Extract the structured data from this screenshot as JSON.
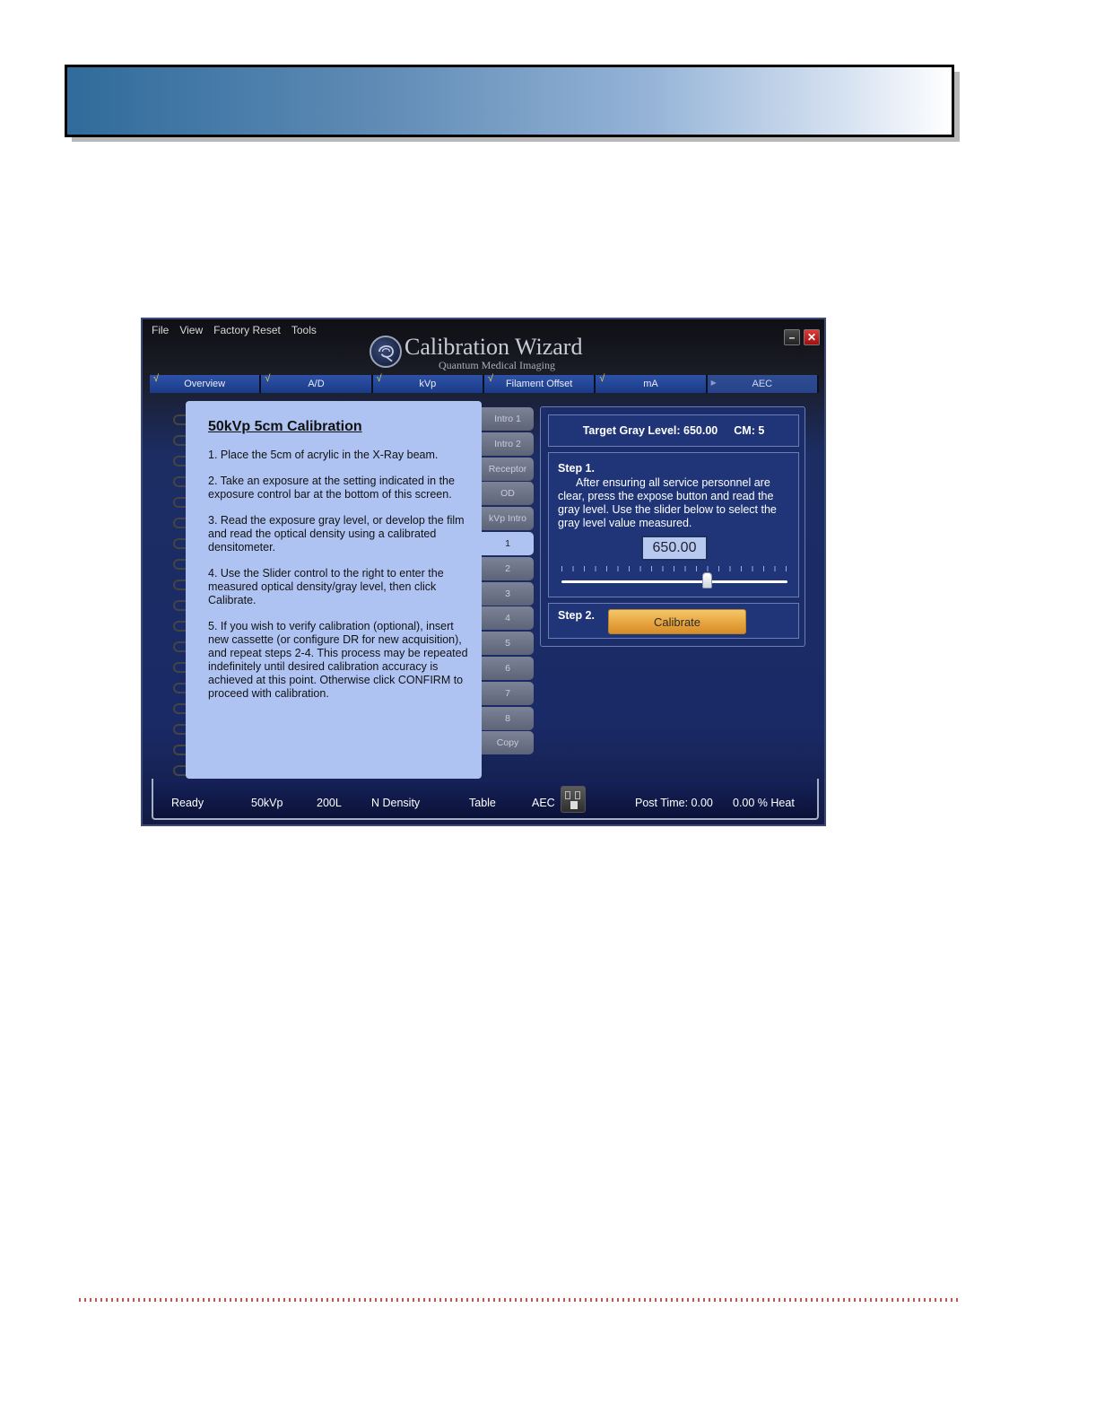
{
  "app": {
    "title": "Calibration Wizard",
    "subtitle": "Quantum Medical Imaging"
  },
  "menu": [
    "File",
    "View",
    "Factory Reset",
    "Tools"
  ],
  "window_controls": {
    "minimize": "–",
    "close": "✕"
  },
  "main_tabs": [
    {
      "label": "Overview",
      "checked": true
    },
    {
      "label": "A/D",
      "checked": true
    },
    {
      "label": "kVp",
      "checked": true
    },
    {
      "label": "Filament Offset",
      "checked": true
    },
    {
      "label": "mA",
      "checked": true
    },
    {
      "label": "AEC",
      "checked": false,
      "active": true
    }
  ],
  "notebook": {
    "title": "50kVp  5cm  Calibration",
    "steps": [
      "1. Place the 5cm of acrylic in the X-Ray beam.",
      "2. Take an exposure at the setting indicated in the exposure control bar at the bottom of this screen.",
      "3. Read the exposure gray level, or develop the film and read the optical density using a calibrated densitometer.",
      "4. Use the Slider control to the right to enter the measured optical density/gray level, then click Calibrate.",
      "5. If you wish to verify calibration (optional), insert new cassette (or configure DR for new acquisition), and repeat steps 2-4.  This process may be repeated indefinitely until desired calibration accuracy is achieved at this point.  Otherwise click CONFIRM to proceed with calibration."
    ]
  },
  "side_tabs": [
    "Intro 1",
    "Intro 2",
    "Receptor",
    "OD",
    "kVp Intro",
    "1",
    "2",
    "3",
    "4",
    "5",
    "6",
    "7",
    "8",
    "Copy"
  ],
  "side_tab_active": "1",
  "target": {
    "gray_level": "Target Gray Level: 650.00",
    "cm": "CM: 5"
  },
  "step1": {
    "title": "Step 1.",
    "text": "After ensuring all service personnel are clear, press the expose button and read the gray level. Use the slider below to select the gray level value measured.",
    "value": "650.00",
    "slider_fraction": 0.645
  },
  "step2": {
    "title": "Step 2.",
    "button_label": "Calibrate"
  },
  "status_bar": {
    "state": "Ready",
    "kvp": "50kVp",
    "mas": "200L",
    "density": "N Density",
    "table": "Table",
    "aec": "AEC",
    "post_time": "Post Time: 0.00",
    "heat": "0.00 % Heat"
  },
  "colors": {
    "notebook": "#afc3f3",
    "calibrate_button": "#e5a23b",
    "tab_check": "#e8d650",
    "footer_dots": "#c8524f"
  }
}
